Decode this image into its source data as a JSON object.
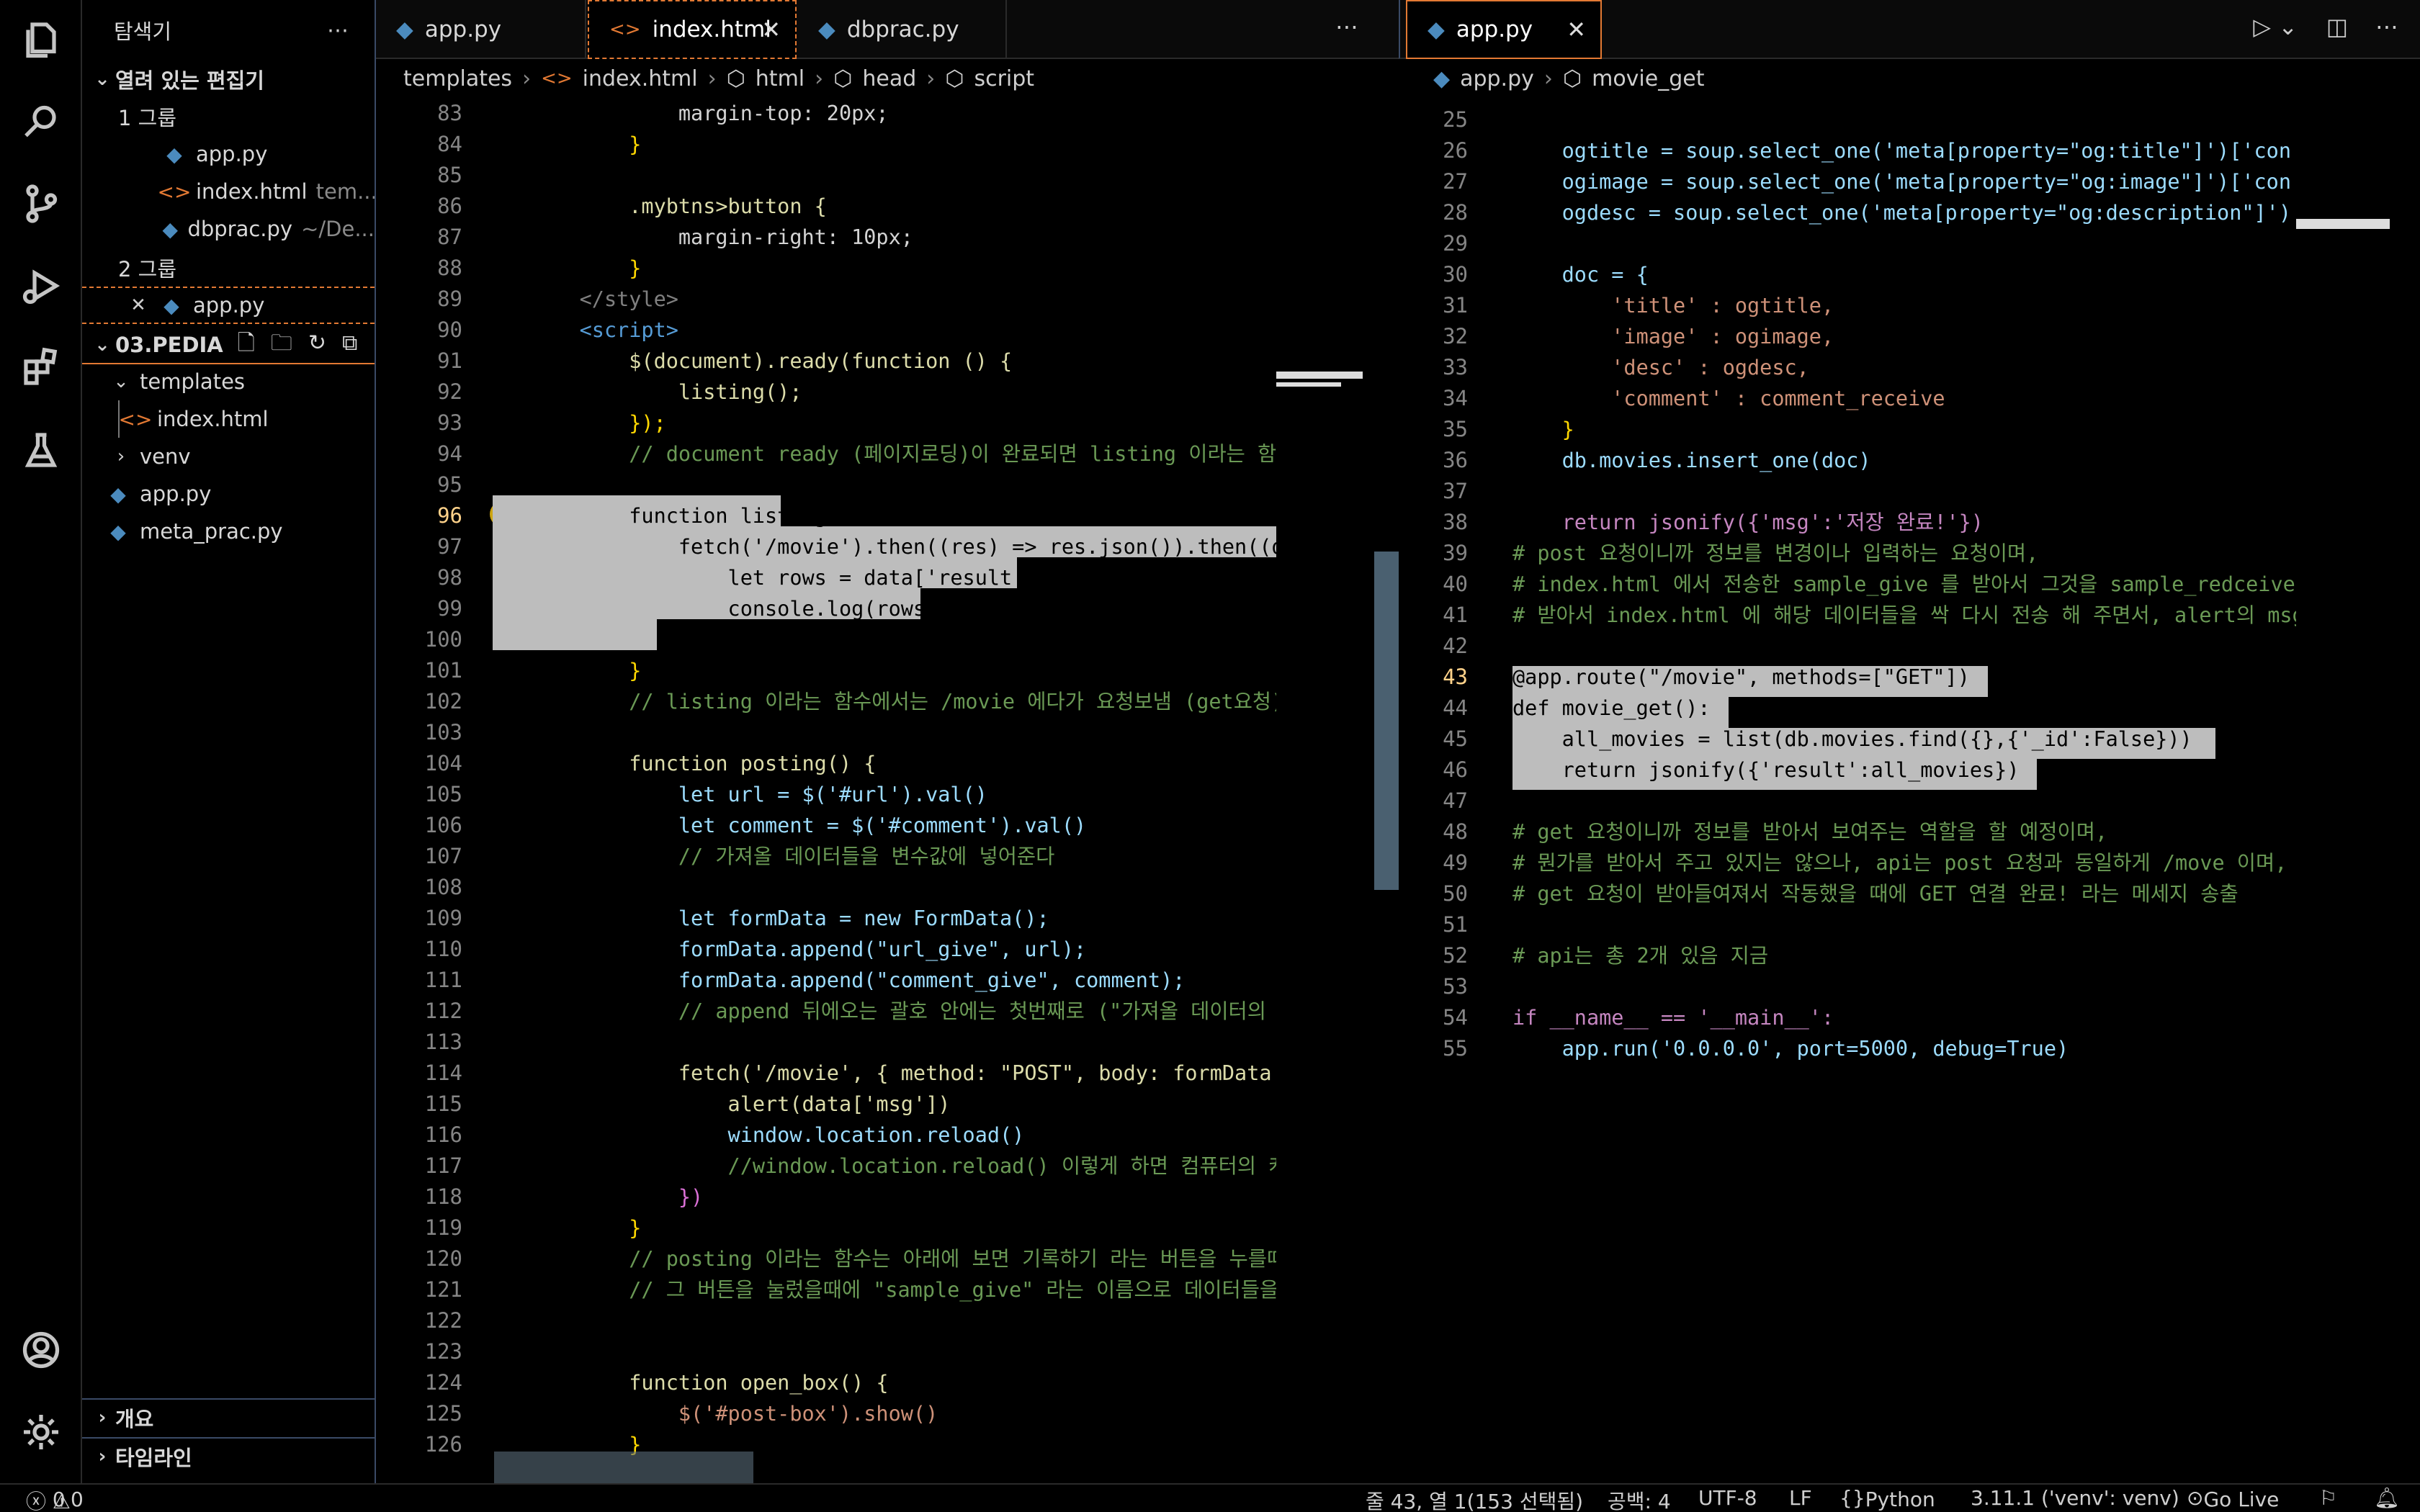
{
  "sidebar": {
    "title": "탐색기",
    "open_editors": "열려 있는 편집기",
    "group1": "1 그룹",
    "group2": "2 그룹",
    "open_items": [
      {
        "name": "app.py",
        "hint": ""
      },
      {
        "name": "index.html",
        "hint": "tem..."
      },
      {
        "name": "dbprac.py",
        "hint": "~/De..."
      }
    ],
    "group2_item": "app.py",
    "project": "03.PEDIA",
    "tree": [
      {
        "name": "templates"
      },
      {
        "name": "index.html"
      },
      {
        "name": "venv"
      },
      {
        "name": "app.py"
      },
      {
        "name": "meta_prac.py"
      }
    ],
    "outline": "개요",
    "timeline": "타임라인"
  },
  "left_tabs": [
    "app.py",
    "index.html",
    "dbprac.py"
  ],
  "right_tabs": [
    "app.py"
  ],
  "left_crumbs": [
    "templates",
    "index.html",
    "html",
    "head",
    "script"
  ],
  "right_crumbs": [
    "app.py",
    "movie_get"
  ],
  "left_code": {
    "line_numbers": [
      "83",
      "84",
      "85",
      "86",
      "87",
      "88",
      "89",
      "90",
      "91",
      "92",
      "93",
      "94",
      "95",
      "96",
      "97",
      "98",
      "99",
      "100",
      "101",
      "102",
      "103",
      "104",
      "105",
      "106",
      "107",
      "108",
      "109",
      "110",
      "111",
      "112",
      "113",
      "114",
      "115",
      "116",
      "117",
      "118",
      "119",
      "120",
      "121",
      "122",
      "123",
      "124",
      "125",
      "126"
    ],
    "l83": "            margin-top: 20px;",
    "l84": "        }",
    "l86": "        .mybtns>button {",
    "l87": "            margin-right: 10px;",
    "l88": "        }",
    "l89": "    </style>",
    "l90": "    <script>",
    "l91": "        $(document).ready(function () {",
    "l92": "            listing();",
    "l93": "        });",
    "l94": "        // document ready (페이지로딩)이 완료되면 listing 이라는 함수를 :",
    "l96": "        function listing() {",
    "l97": "            fetch('/movie').then((res) => res.json()).then((data",
    "l98": "                let rows = data['result']",
    "l99": "                console.log(rows)",
    "l100": "            })",
    "l101": "        }",
    "l102": "        // listing 이라는 함수에서는 /movie 에다가 요청보냄 (get요청)",
    "l104": "        function posting() {",
    "l105": "            let url = $('#url').val()",
    "l106": "            let comment = $('#comment').val()",
    "l107": "            // 가져올 데이터들을 변수값에 넣어준다",
    "l109": "            let formData = new FormData();",
    "l110": "            formData.append(\"url_give\", url);",
    "l111": "            formData.append(\"comment_give\", comment);",
    "l112": "            // append 뒤에오는 괄호 안에는 첫번째로 (\"가져올 데이터의 변수이",
    "l114": "            fetch('/movie', { method: \"POST\", body: formData })",
    "l115": "                alert(data['msg'])",
    "l116": "                window.location.reload()",
    "l117": "                //window.location.reload() 이렇게 하면 컴퓨터의 캐쉬에",
    "l118": "            })",
    "l119": "        }",
    "l120": "        // posting 이라는 함수는 아래에 보면 기록하기 라는 버튼을 누를때 해당",
    "l121": "        // 그 버튼을 눌렀을때에 \"sample_give\" 라는 이름으로 데이터들을 모아서",
    "l124": "        function open_box() {",
    "l125": "            $('#post-box').show()",
    "l126": "        }"
  },
  "right_code": {
    "line_numbers": [
      "25",
      "26",
      "27",
      "28",
      "29",
      "30",
      "31",
      "32",
      "33",
      "34",
      "35",
      "36",
      "37",
      "38",
      "39",
      "40",
      "41",
      "42",
      "43",
      "44",
      "45",
      "46",
      "47",
      "48",
      "49",
      "50",
      "51",
      "52",
      "53",
      "54",
      "55"
    ],
    "l26": "    ogtitle = soup.select_one('meta[property=\"og:title\"]')['con",
    "l27": "    ogimage = soup.select_one('meta[property=\"og:image\"]')['con",
    "l28": "    ogdesc = soup.select_one('meta[property=\"og:description\"]')",
    "l30": "    doc = {",
    "l31": "        'title' : ogtitle,",
    "l32": "        'image' : ogimage,",
    "l33": "        'desc' : ogdesc,",
    "l34": "        'comment' : comment_receive",
    "l35": "    }",
    "l36": "    db.movies.insert_one(doc)",
    "l38": "    return jsonify({'msg':'저장 완료!'})",
    "l39": "# post 요청이니까 정보를 변경이나 입력하는 요청이며,",
    "l40": "# index.html 에서 전송한 sample_give 를 받아서 그것을 sample_redceive",
    "l41": "# 받아서 index.html 에 해당 데이터들을 싹 다시 전송 해 주면서, alert의 msg",
    "l43": "@app.route(\"/movie\", methods=[\"GET\"])",
    "l44": "def movie_get():",
    "l45": "    all_movies = list(db.movies.find({},{'_id':False}))",
    "l46": "    return jsonify({'result':all_movies})",
    "l48": "# get 요청이니까 정보를 받아서 보여주는 역할을 할 예정이며,",
    "l49": "# 뭔가를 받아서 주고 있지는 않으나, api는 post 요청과 동일하게 /move 이며,",
    "l50": "# get 요청이 받아들여져서 작동했을 때에 GET 연결 완료! 라는 메세지 송출",
    "l52": "# api는 총 2개 있음 지금",
    "l54": "if __name__ == '__main__':",
    "l55": "    app.run('0.0.0.0', port=5000, debug=True)"
  },
  "status": {
    "errors": "0",
    "warnings": "0",
    "position": "줄 43, 열 1(153 선택됨)",
    "spaces": "공백: 4",
    "encoding": "UTF-8",
    "eol": "LF",
    "language": "Python",
    "interpreter": "3.11.1 ('venv': venv)",
    "golive": "Go Live"
  }
}
